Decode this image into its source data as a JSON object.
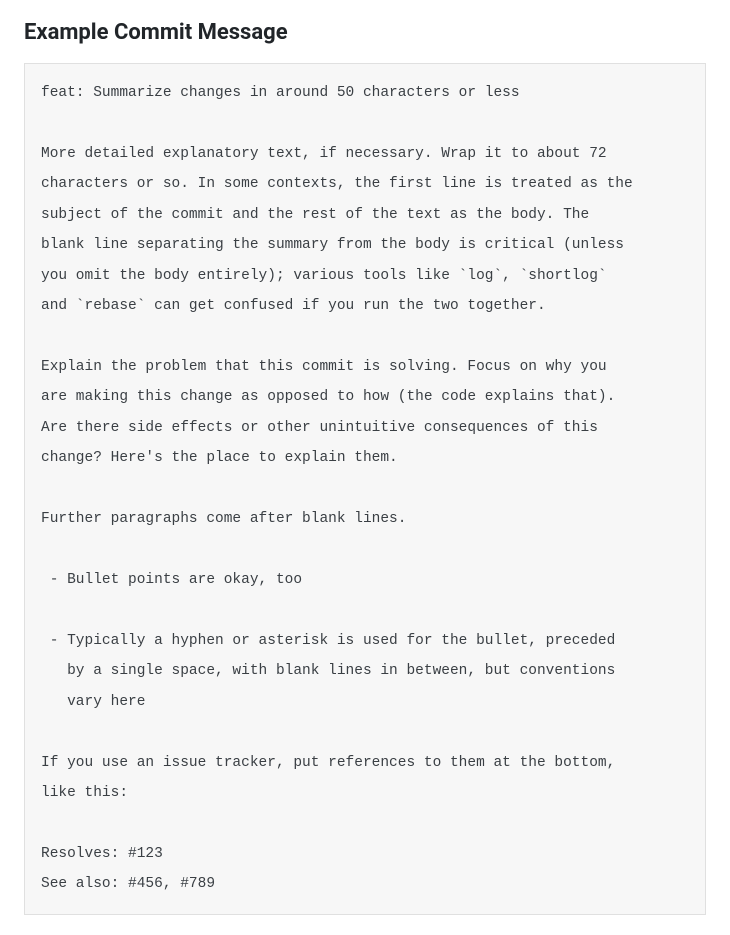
{
  "heading": "Example Commit Message",
  "commit_message": "feat: Summarize changes in around 50 characters or less\n\nMore detailed explanatory text, if necessary. Wrap it to about 72\ncharacters or so. In some contexts, the first line is treated as the\nsubject of the commit and the rest of the text as the body. The\nblank line separating the summary from the body is critical (unless\nyou omit the body entirely); various tools like `log`, `shortlog`\nand `rebase` can get confused if you run the two together.\n\nExplain the problem that this commit is solving. Focus on why you\nare making this change as opposed to how (the code explains that).\nAre there side effects or other unintuitive consequences of this\nchange? Here's the place to explain them.\n\nFurther paragraphs come after blank lines.\n\n - Bullet points are okay, too\n\n - Typically a hyphen or asterisk is used for the bullet, preceded\n   by a single space, with blank lines in between, but conventions\n   vary here\n\nIf you use an issue tracker, put references to them at the bottom,\nlike this:\n\nResolves: #123\nSee also: #456, #789"
}
